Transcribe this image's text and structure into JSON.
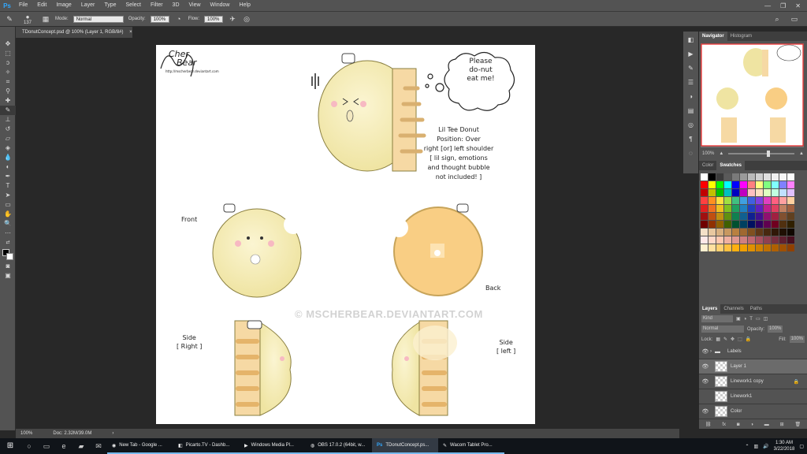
{
  "menubar": {
    "logo": "Ps",
    "items": [
      "File",
      "Edit",
      "Image",
      "Layer",
      "Type",
      "Select",
      "Filter",
      "3D",
      "View",
      "Window",
      "Help"
    ],
    "window_controls": [
      "—",
      "❐",
      "✕"
    ]
  },
  "options": {
    "brush_size": "137",
    "mode_label": "Mode:",
    "mode_value": "Normal",
    "opacity_label": "Opacity:",
    "opacity_value": "100%",
    "flow_label": "Flow:",
    "flow_value": "100%"
  },
  "document_tab": {
    "title": "TDonutConcept.psd @ 100% (Layer 1, RGB/8#)",
    "close": "×"
  },
  "status": {
    "zoom": "100%",
    "doc_info": "Doc: 2.32M/39.0M"
  },
  "artwork": {
    "signature_lines": [
      "Cher",
      "Bear"
    ],
    "signature_url": "http://mscherbear.deviantart.com",
    "thought_bubble": [
      "Please",
      "do-nut",
      "eat me!"
    ],
    "description": [
      "Lil Tee Donut",
      "Position: Over",
      "right [or] left shoulder",
      "[ lil sign, emotions",
      "and thought bubble",
      "not included! ]"
    ],
    "label_front": "Front",
    "label_back": "Back",
    "label_side_right": [
      "Side",
      "[ Right ]"
    ],
    "label_side_left": [
      "Side",
      "[ left ]"
    ],
    "watermark": "© MSCHERBEAR.DEVIANTART.COM"
  },
  "navigator": {
    "tabs": [
      "Navigator",
      "Histogram"
    ],
    "zoom": "100%"
  },
  "color_panel": {
    "tabs": [
      "Color",
      "Swatches"
    ]
  },
  "swatch_colors": [
    "#ffffff",
    "#000000",
    "#3a3a3a",
    "#5a5a5a",
    "#7a7a7a",
    "#9a9a9a",
    "#bababa",
    "#d0d0d0",
    "#e0e0e0",
    "#efefef",
    "#f6f6f6",
    "#fcfcfc",
    "#ff0000",
    "#ffff00",
    "#00ff00",
    "#00ffff",
    "#0000ff",
    "#ff00ff",
    "#ff8080",
    "#ffff80",
    "#80ff80",
    "#80ffff",
    "#8080ff",
    "#ff80ff",
    "#c00000",
    "#c0c000",
    "#00c000",
    "#00c0c0",
    "#0000c0",
    "#c000c0",
    "#ffc0c0",
    "#ffe0c0",
    "#e0ffc0",
    "#c0ffe0",
    "#c0e0ff",
    "#e0c0ff",
    "#ff4040",
    "#ff9020",
    "#ffe040",
    "#a0e040",
    "#40c080",
    "#40a0e0",
    "#4060e0",
    "#8040e0",
    "#e040c0",
    "#ff6080",
    "#ffa0a0",
    "#ffd0a0",
    "#e02020",
    "#f07020",
    "#f0c020",
    "#80c020",
    "#20a060",
    "#2080c0",
    "#2040c0",
    "#6020c0",
    "#c02090",
    "#e04060",
    "#c08060",
    "#a06040",
    "#a01010",
    "#c05010",
    "#c09010",
    "#609010",
    "#108050",
    "#106090",
    "#102090",
    "#401090",
    "#901070",
    "#a02040",
    "#805030",
    "#604020",
    "#700000",
    "#903000",
    "#906000",
    "#406000",
    "#005030",
    "#004060",
    "#001060",
    "#300060",
    "#600050",
    "#700020",
    "#503010",
    "#302000",
    "#f4e0c8",
    "#e8c8a0",
    "#d8b080",
    "#c89860",
    "#b88040",
    "#a06830",
    "#805020",
    "#603818",
    "#482810",
    "#301808",
    "#201004",
    "#100800",
    "#ffe8e8",
    "#ffd8c8",
    "#ffc8b0",
    "#f0b0a0",
    "#e09890",
    "#d08080",
    "#c06870",
    "#a85060",
    "#904050",
    "#783040",
    "#602030",
    "#481020",
    "#fff0d0",
    "#ffe0a0",
    "#ffd070",
    "#ffc040",
    "#ffb010",
    "#f0a000",
    "#e09000",
    "#d08000",
    "#c07000",
    "#b06000",
    "#a05000",
    "#904000"
  ],
  "layers_panel": {
    "tabs": [
      "Layers",
      "Channels",
      "Paths"
    ],
    "kind": "Kind",
    "blend": "Normal",
    "opacity_label": "Opacity:",
    "opacity_value": "100%",
    "lock_label": "Lock:",
    "fill_label": "Fill:",
    "fill_value": "100%",
    "layers": [
      {
        "name": "Labels",
        "type": "group"
      },
      {
        "name": "Layer 1",
        "type": "layer",
        "selected": true
      },
      {
        "name": "Linework1 copy",
        "type": "layer",
        "locked": true
      },
      {
        "name": "Linework1",
        "type": "layer"
      },
      {
        "name": "Color",
        "type": "layer"
      }
    ]
  },
  "taskbar": {
    "apps": [
      {
        "label": "New Tab - Google ...",
        "icon": "◉"
      },
      {
        "label": "Picarto.TV - Dashb...",
        "icon": "◧"
      },
      {
        "label": "Windows Media Pl...",
        "icon": "▶"
      },
      {
        "label": "OBS 17.0.2 (64bit, w...",
        "icon": "◍"
      },
      {
        "label": "TDonutConcept.ps...",
        "icon": "Ps"
      },
      {
        "label": "Wacom Tablet Pro...",
        "icon": "✎"
      }
    ],
    "time": "1:30 AM",
    "date": "3/22/2018"
  }
}
